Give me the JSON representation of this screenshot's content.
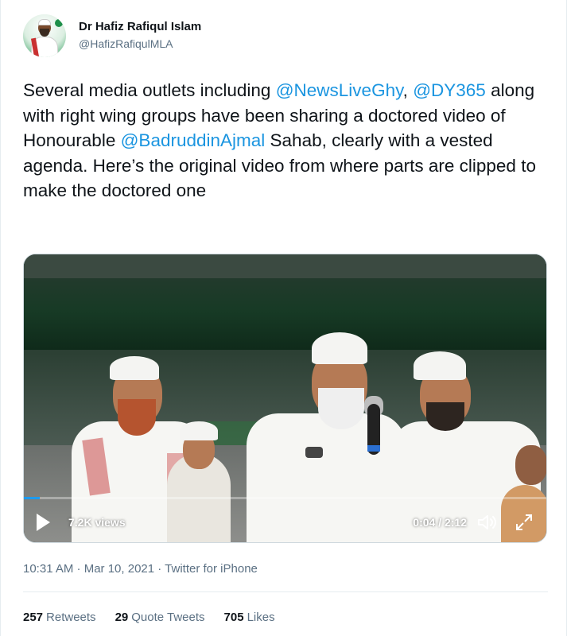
{
  "author": {
    "name": "Dr Hafiz Rafiqul Islam",
    "handle": "@HafizRafiqulMLA"
  },
  "tweet": {
    "segments": [
      {
        "text": "Several media outlets including ",
        "type": "text"
      },
      {
        "text": "@NewsLiveGhy",
        "type": "mention"
      },
      {
        "text": ", ",
        "type": "text"
      },
      {
        "text": "@DY365",
        "type": "mention"
      },
      {
        "text": " along with right wing groups have been sharing a doctored video of Honourable ",
        "type": "text"
      },
      {
        "text": "@BadruddinAjmal",
        "type": "mention"
      },
      {
        "text": " Sahab, clearly with a vested agenda. Here’s the original video from where parts are clipped to make the doctored one",
        "type": "text"
      }
    ]
  },
  "video": {
    "views": "7.2K views",
    "time": "0:04 / 2:12",
    "progress": 0.03
  },
  "meta": {
    "timestamp": "10:31 AM · Mar 10, 2021 · Twitter for iPhone"
  },
  "stats": {
    "retweets_count": "257",
    "retweets_label": "Retweets",
    "quotes_count": "29",
    "quotes_label": "Quote Tweets",
    "likes_count": "705",
    "likes_label": "Likes"
  },
  "colors": {
    "link": "#1b95e0",
    "secondary_text": "#5b7083",
    "primary_text": "#0f1419"
  }
}
